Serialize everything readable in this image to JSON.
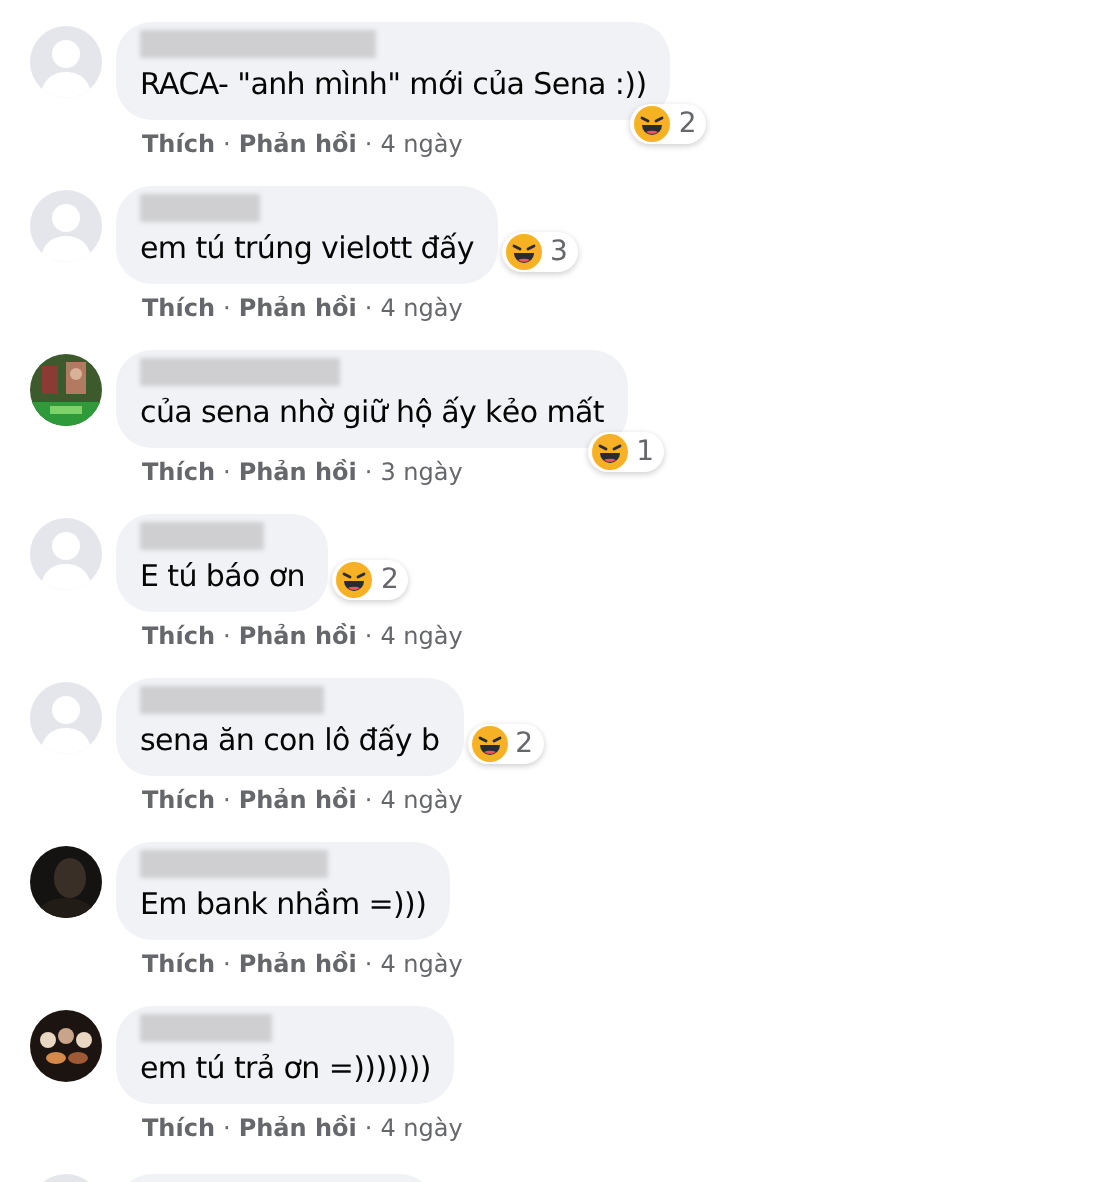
{
  "comments": [
    {
      "avatar": {
        "kind": "default"
      },
      "text": "RACA- \"anh mình\" mới của Sena :))",
      "reaction": {
        "kind": "corner",
        "count": "2"
      },
      "actions": [
        {
          "kind": "link",
          "text": "Thích"
        },
        {
          "kind": "separator",
          "text": "·"
        },
        {
          "kind": "link",
          "text": "Phản hồi"
        },
        {
          "kind": "separator",
          "text": "·"
        },
        {
          "kind": "time",
          "text": "4 ngày"
        }
      ]
    },
    {
      "avatar": {
        "kind": "default"
      },
      "text": "em tú trúng vielott đấy",
      "reaction": {
        "kind": "side",
        "count": "3"
      },
      "actions": [
        {
          "kind": "link",
          "text": "Thích"
        },
        {
          "kind": "separator",
          "text": "·"
        },
        {
          "kind": "link",
          "text": "Phản hồi"
        },
        {
          "kind": "separator",
          "text": "·"
        },
        {
          "kind": "time",
          "text": "4 ngày"
        }
      ]
    },
    {
      "avatar": {
        "kind": "green-photo"
      },
      "text": "của sena nhờ giữ hộ ấy kẻo mất",
      "reaction": {
        "kind": "corner",
        "count": "1"
      },
      "actions": [
        {
          "kind": "link",
          "text": "Thích"
        },
        {
          "kind": "separator",
          "text": "·"
        },
        {
          "kind": "link",
          "text": "Phản hồi"
        },
        {
          "kind": "separator",
          "text": "·"
        },
        {
          "kind": "time",
          "text": "3 ngày"
        }
      ]
    },
    {
      "avatar": {
        "kind": "default"
      },
      "text": "E tú báo ơn",
      "reaction": {
        "kind": "side",
        "count": "2"
      },
      "actions": [
        {
          "kind": "link",
          "text": "Thích"
        },
        {
          "kind": "separator",
          "text": "·"
        },
        {
          "kind": "link",
          "text": "Phản hồi"
        },
        {
          "kind": "separator",
          "text": "·"
        },
        {
          "kind": "time",
          "text": "4 ngày"
        }
      ]
    },
    {
      "avatar": {
        "kind": "default"
      },
      "text": "sena ăn con lô đấy b",
      "reaction": {
        "kind": "side",
        "count": "2"
      },
      "actions": [
        {
          "kind": "link",
          "text": "Thích"
        },
        {
          "kind": "separator",
          "text": "·"
        },
        {
          "kind": "link",
          "text": "Phản hồi"
        },
        {
          "kind": "separator",
          "text": "·"
        },
        {
          "kind": "time",
          "text": "4 ngày"
        }
      ]
    },
    {
      "avatar": {
        "kind": "dark-photo"
      },
      "text": "Em bank nhầm =)))",
      "actions": [
        {
          "kind": "link",
          "text": "Thích"
        },
        {
          "kind": "separator",
          "text": "·"
        },
        {
          "kind": "link",
          "text": "Phản hồi"
        },
        {
          "kind": "separator",
          "text": "·"
        },
        {
          "kind": "time",
          "text": "4 ngày"
        }
      ]
    },
    {
      "avatar": {
        "kind": "lights-photo"
      },
      "text": "em tú trả ơn =)))))))",
      "actions": [
        {
          "kind": "link",
          "text": "Thích"
        },
        {
          "kind": "separator",
          "text": "·"
        },
        {
          "kind": "link",
          "text": "Phản hồi"
        },
        {
          "kind": "separator",
          "text": "·"
        },
        {
          "kind": "time",
          "text": "4 ngày"
        }
      ]
    }
  ]
}
